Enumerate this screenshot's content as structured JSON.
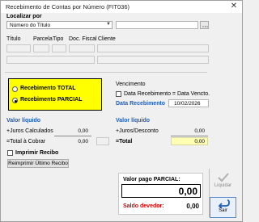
{
  "window": {
    "title": "Recebimento de Contas por Número (FIT036)",
    "close": "✕"
  },
  "search": {
    "label": "Localizar por",
    "mode_value": "Número do Título",
    "query_value": ""
  },
  "grid": {
    "headers": [
      "Título",
      "Parcela",
      "Tipo",
      "Doc. Fiscal",
      "Cliente"
    ]
  },
  "receipt_type": {
    "total_label": "Recebimento TOTAL",
    "partial_label": "Recebimento PARCIAL",
    "selected": "partial"
  },
  "dates": {
    "vencimento_label": "Vencimento",
    "same_as_due_label": "Data Recebimento = Data Vencto.",
    "recebimento_label": "Data Recebimento",
    "recebimento_value": "10/02/2026"
  },
  "left_summary": {
    "valor_liquido_label": "Valor líquido",
    "juros_label": "+Juros Calculados",
    "juros_value": "0,00",
    "total_label": "=Total à Cobrar",
    "total_value": "0,00"
  },
  "right_summary": {
    "valor_liquido_label": "Valor líquido",
    "juros_label": "+Juros/Desconto",
    "juros_value": "0,00",
    "total_label": "=Total",
    "total_value": "0,00"
  },
  "print": {
    "checkbox_label": "Imprimir Recibo",
    "reprint_label": "Reimprimir Último Recibo"
  },
  "payment": {
    "paid_label": "Valor pago PARCIAL:",
    "paid_value": "0,00",
    "balance_label": "Saldo devedor:",
    "balance_value": "0,00"
  },
  "actions": {
    "liquidar_label": "Liquidar",
    "sair_label": "Sair"
  },
  "colors": {
    "accent_blue": "#1f5fb4",
    "highlight_yellow": "#ffff00",
    "balance_red": "#d00000"
  }
}
